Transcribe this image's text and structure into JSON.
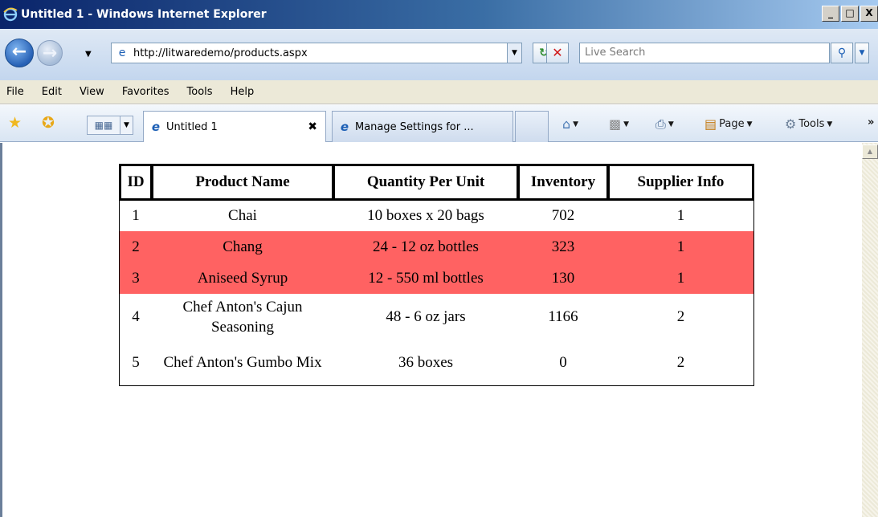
{
  "window": {
    "title": "Untitled 1 - Windows Internet Explorer",
    "controls": [
      "_",
      "□",
      "X"
    ]
  },
  "address_bar": {
    "url": "http://litwaredemo/products.aspx",
    "search_placeholder": "Live Search"
  },
  "menu": [
    "File",
    "Edit",
    "View",
    "Favorites",
    "Tools",
    "Help"
  ],
  "tabs": [
    {
      "label": "Untitled 1",
      "active": true
    },
    {
      "label": "Manage Settings for ...",
      "active": false
    }
  ],
  "command_bar": {
    "page_label": "Page",
    "tools_label": "Tools"
  },
  "table": {
    "headers": [
      "ID",
      "Product Name",
      "Quantity Per Unit",
      "Inventory",
      "Supplier Info"
    ],
    "rows": [
      {
        "id": "1",
        "name": "Chai",
        "qty": "10 boxes x 20 bags",
        "inventory": "702",
        "supplier": "1",
        "highlight": false
      },
      {
        "id": "2",
        "name": "Chang",
        "qty": "24 - 12 oz bottles",
        "inventory": "323",
        "supplier": "1",
        "highlight": true
      },
      {
        "id": "3",
        "name": "Aniseed Syrup",
        "qty": "12 - 550 ml bottles",
        "inventory": "130",
        "supplier": "1",
        "highlight": true
      },
      {
        "id": "4",
        "name": "Chef Anton's Cajun Seasoning",
        "qty": "48 - 6 oz jars",
        "inventory": "1166",
        "supplier": "2",
        "highlight": false
      },
      {
        "id": "5",
        "name": "Chef Anton's Gumbo Mix",
        "qty": "36 boxes",
        "inventory": "0",
        "supplier": "2",
        "highlight": false
      }
    ],
    "highlight_color": "#ff6262"
  }
}
